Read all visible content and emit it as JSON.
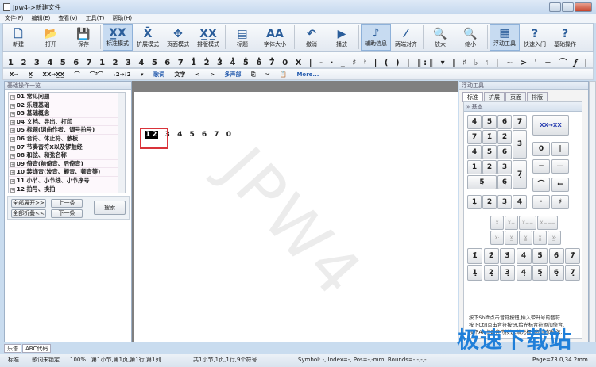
{
  "window": {
    "title": "Jpw4->新建文件"
  },
  "menu": [
    "文件(F)",
    "编辑(E)",
    "查看(V)",
    "工具(T)",
    "帮助(H)"
  ],
  "toolbar": [
    {
      "label": "新建",
      "icon": "new-file-icon",
      "g": "🗋"
    },
    {
      "label": "打开",
      "icon": "open-folder-icon",
      "g": "📂"
    },
    {
      "label": "保存",
      "icon": "save-icon",
      "g": "💾"
    },
    {
      "label": "标准模式",
      "icon": "standard-mode-icon",
      "g": "X̲X",
      "on": true
    },
    {
      "label": "扩展模式",
      "icon": "extended-mode-icon",
      "g": "X̄"
    },
    {
      "label": "页面模式",
      "icon": "page-mode-icon",
      "g": "✥"
    },
    {
      "label": "排版模式",
      "icon": "layout-mode-icon",
      "g": "X̲X̲"
    },
    {
      "label": "标题",
      "icon": "title-icon",
      "g": "▤"
    },
    {
      "label": "字体大小",
      "icon": "font-size-icon",
      "g": "AA"
    },
    {
      "label": "撤消",
      "icon": "undo-icon",
      "g": "↶"
    },
    {
      "label": "播放",
      "icon": "play-icon",
      "g": "▶"
    },
    {
      "label": "辅助信息",
      "icon": "aux-info-icon",
      "g": "♪",
      "on": true
    },
    {
      "label": "两端对齐",
      "icon": "justify-icon",
      "g": "⁄"
    },
    {
      "label": "放大",
      "icon": "zoom-in-icon",
      "g": "🔍"
    },
    {
      "label": "缩小",
      "icon": "zoom-out-icon",
      "g": "🔍"
    },
    {
      "label": "浮动工具",
      "icon": "float-tools-icon",
      "g": "▦",
      "on": true
    },
    {
      "label": "快速入门",
      "icon": "quick-start-icon",
      "g": "?"
    },
    {
      "label": "基础操作",
      "icon": "basic-ops-icon",
      "g": "?"
    }
  ],
  "notes_toolbar": "1 2 3 4 5 6 7 1 2 3 4 5 6 7 1̇ 2̇ 3̇ 4̇ 5̇ 6̇ 7̇ 0 X | - · _ ♯ ♮ | ( ) | ‖:‖ ▾ | ♯ ♭ ♮ | ~ > ' − ⌒ 𝆑 | 2/4 3/4 4/4 ▾ ♩",
  "toolbar3": {
    "a": "X→ X̲",
    "b": "XX→X̲X̲",
    "c": "⌒",
    "d": "⌒³⌒",
    "e": "♭2→♭2 ▾",
    "lyrics": "歌词",
    "text": "文字",
    "cresc": "<",
    "dim": ">",
    "multi": "多声部",
    "more": "More..."
  },
  "left_panel": {
    "title": "基础操作一览",
    "items": [
      "01 常见问题",
      "02 乐理基础",
      "03 基础概念",
      "04 文档、导出、打印",
      "05 标题(词曲作者、调号拍号)",
      "06 音符、休止符、散板",
      "07 节奏音符X以及锣鼓经",
      "08 和弦、和弦名称",
      "09 倚音(前倚音、后倚音)",
      "10 装饰音(波音、颤音、顿音等)",
      "11 小节、小节线、小节序号",
      "12 拍号、换拍"
    ],
    "expand_all": "全部展开>>",
    "collapse_all": "全部折叠<<",
    "prev": "上一条",
    "next": "下一条",
    "search": "搜索"
  },
  "score": {
    "selected": [
      "1",
      "2"
    ],
    "notes": [
      "3",
      "4",
      "5",
      "6",
      "7",
      "0"
    ],
    "watermark": "JPW4"
  },
  "right_panel": {
    "title": "浮动工具",
    "tabs": [
      "标准",
      "扩展",
      "页面",
      "排版"
    ],
    "section": "基本",
    "convert": "XX→X̲X̲",
    "help": [
      "按下Shift点击音符按钮,插入带升号的音符.",
      "按下Ctrl点击音符按钮,给光标音符添加倚音.",
      "按下Alt点击音符按钮,给光标音符添加和弦."
    ]
  },
  "bottom_tabs": [
    "乐谱",
    "ABC代码"
  ],
  "status": {
    "mode": "标准",
    "lyrics": "歌词未锁定",
    "zoom": "100%",
    "pos": "第1小节,第1页,第1行,第1列",
    "total": "共1小节,1页,1行,9个符号",
    "symbol": "Symbol: -, Index=-, Pos=-,-mm, Bounds=-,-,-,-",
    "page": "Page=73.0,34.2mm"
  },
  "logo": "极速下载站"
}
